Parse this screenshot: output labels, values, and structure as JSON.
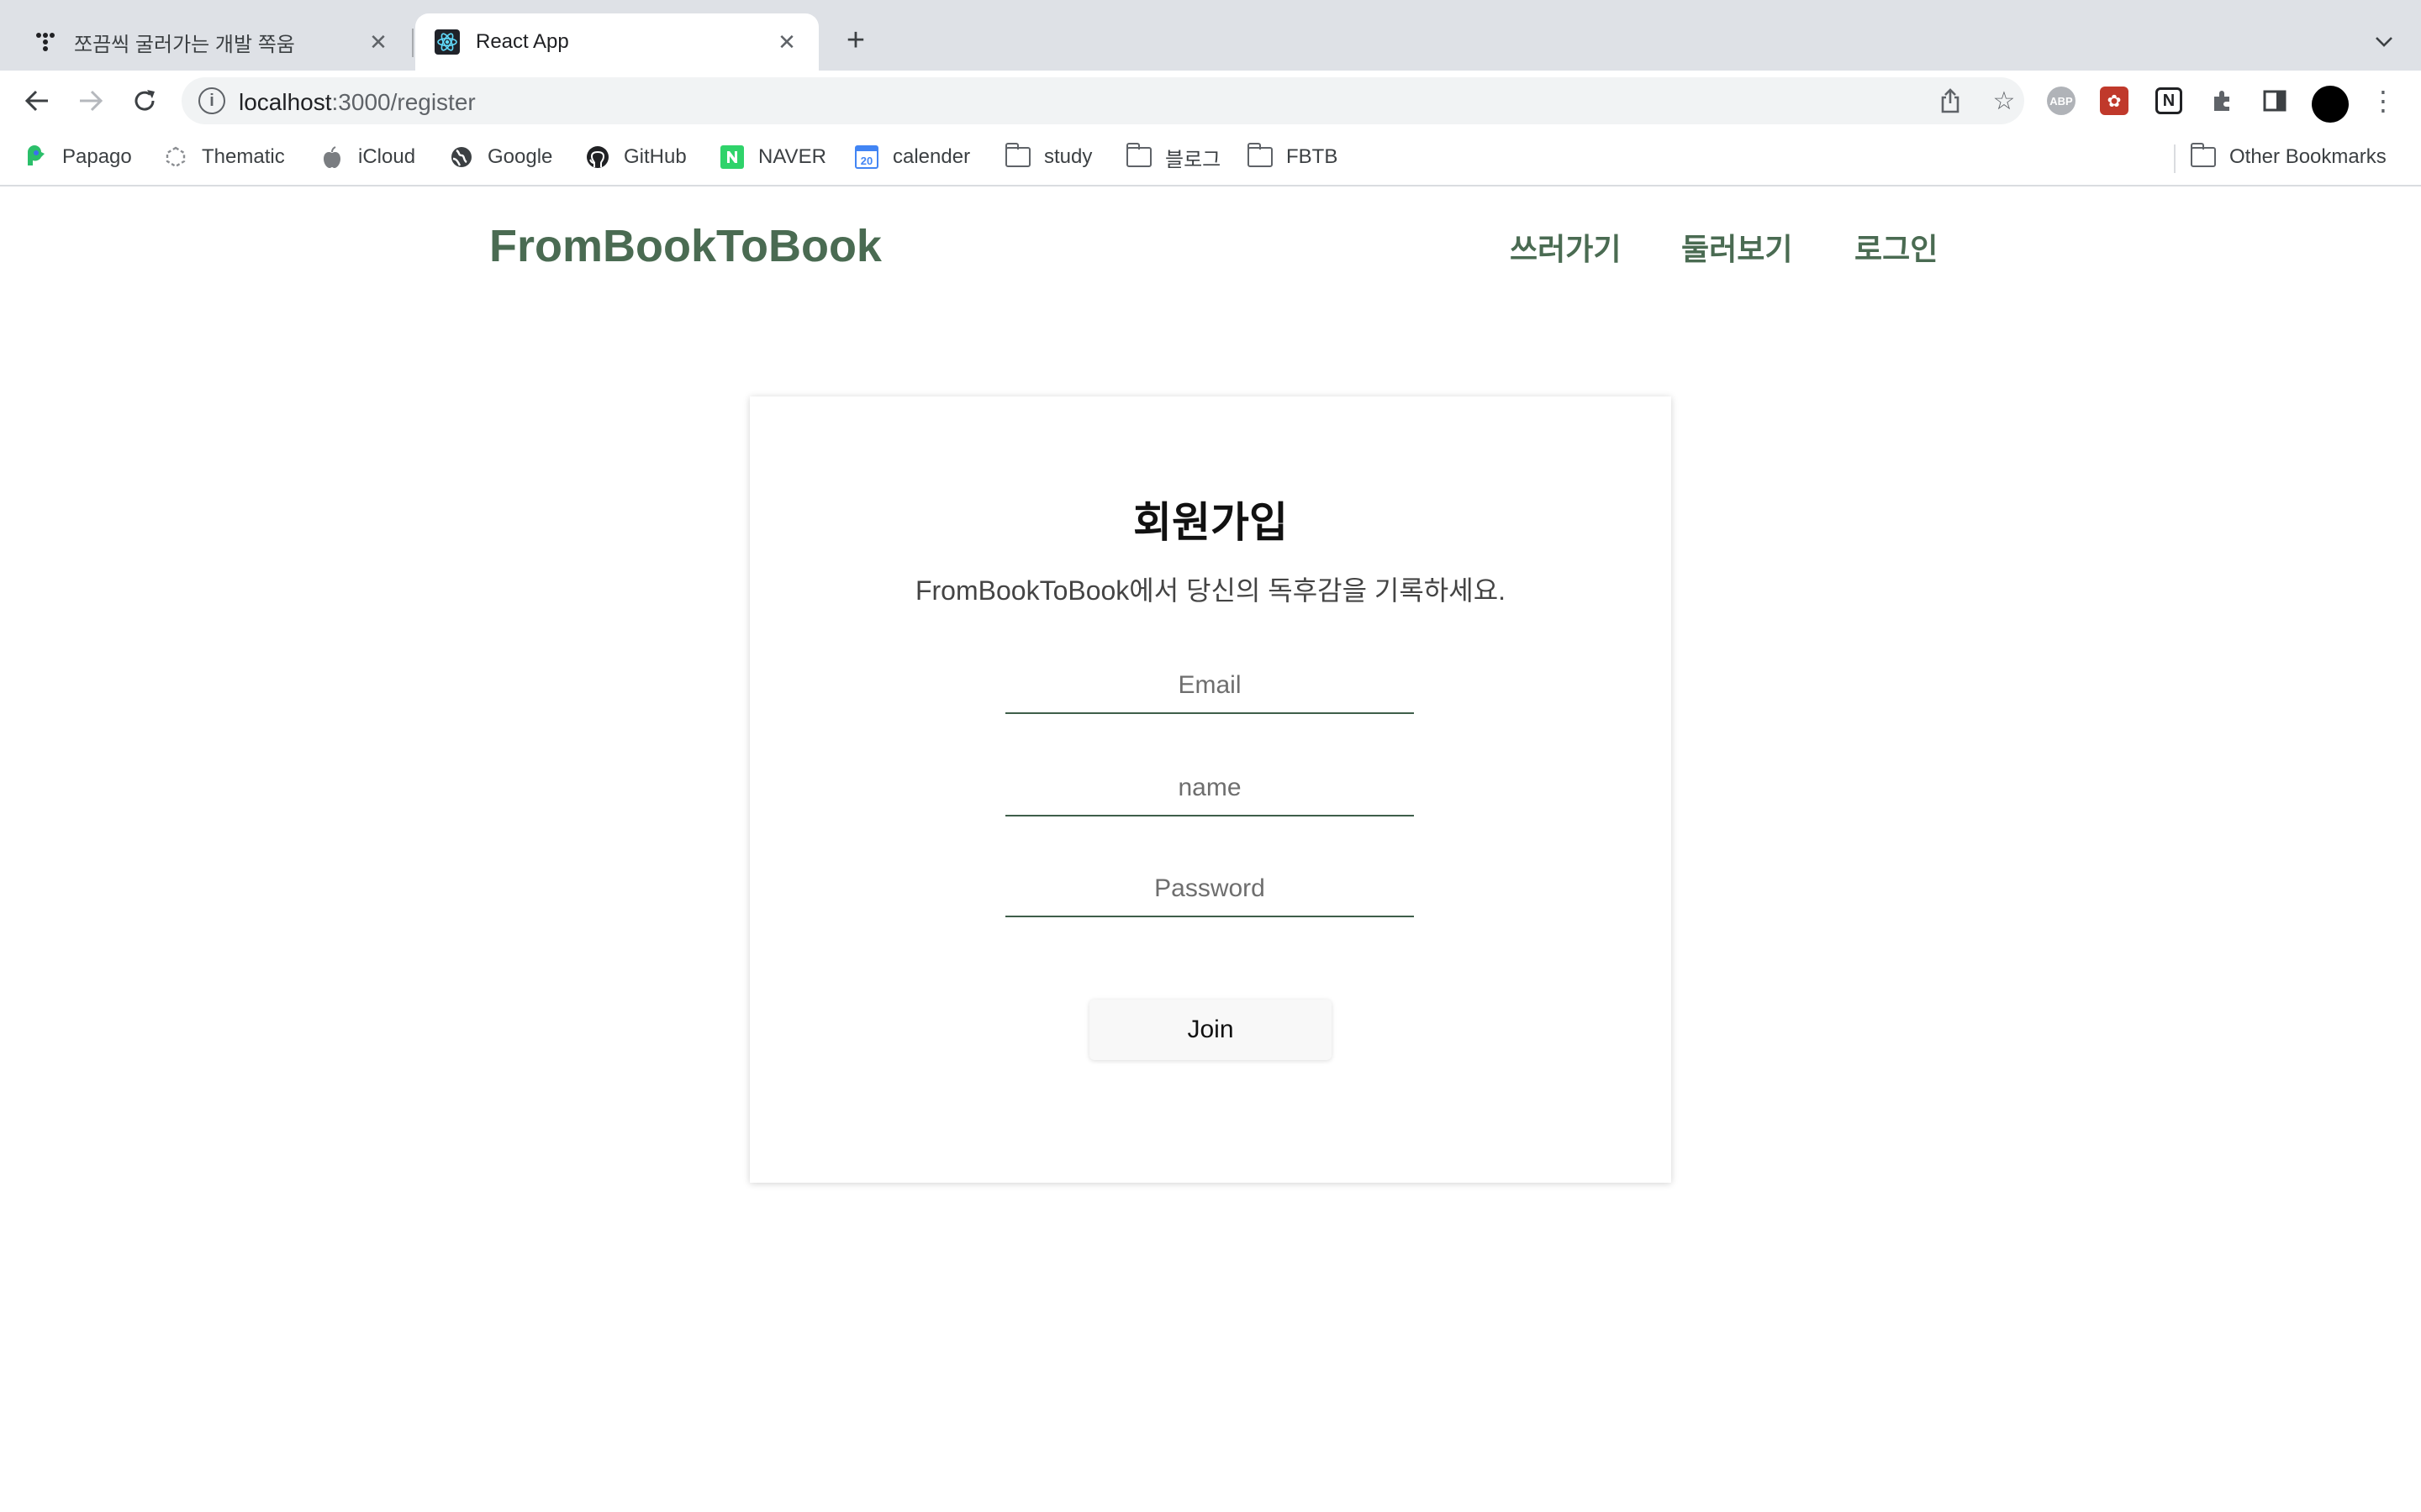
{
  "browser": {
    "tabs": [
      {
        "title": "쪼끔씩 굴러가는 개발 쪽움",
        "active": false,
        "favicon": "tistory-dots-icon"
      },
      {
        "title": "React App",
        "active": true,
        "favicon": "react-icon"
      }
    ],
    "new_tab_label": "+",
    "url_host": "localhost",
    "url_path": ":3000/register",
    "extensions": [
      "adblock-plus",
      "red-extension",
      "notion-web-clipper",
      "puzzle-icon",
      "sidebar-icon"
    ],
    "bookmarks": [
      {
        "label": "Papago",
        "icon": "papago-icon"
      },
      {
        "label": "Thematic",
        "icon": "thematic-icon"
      },
      {
        "label": "iCloud",
        "icon": "apple-icon"
      },
      {
        "label": "Google",
        "icon": "globe-icon"
      },
      {
        "label": "GitHub",
        "icon": "github-icon"
      },
      {
        "label": "NAVER",
        "icon": "naver-icon"
      },
      {
        "label": "calender",
        "icon": "calendar-icon"
      },
      {
        "label": "study",
        "icon": "folder-icon"
      },
      {
        "label": "블로그",
        "icon": "folder-icon"
      },
      {
        "label": "FBTB",
        "icon": "folder-icon"
      }
    ],
    "other_bookmarks": "Other Bookmarks"
  },
  "site": {
    "logo": "FromBookToBook",
    "nav": [
      "쓰러가기",
      "둘러보기",
      "로그인"
    ],
    "brand_color": "#4a6b52"
  },
  "register": {
    "title": "회원가입",
    "subtitle": "FromBookToBook에서 당신의 독후감을 기록하세요.",
    "email_placeholder": "Email",
    "name_placeholder": "name",
    "password_placeholder": "Password",
    "join_label": "Join"
  }
}
